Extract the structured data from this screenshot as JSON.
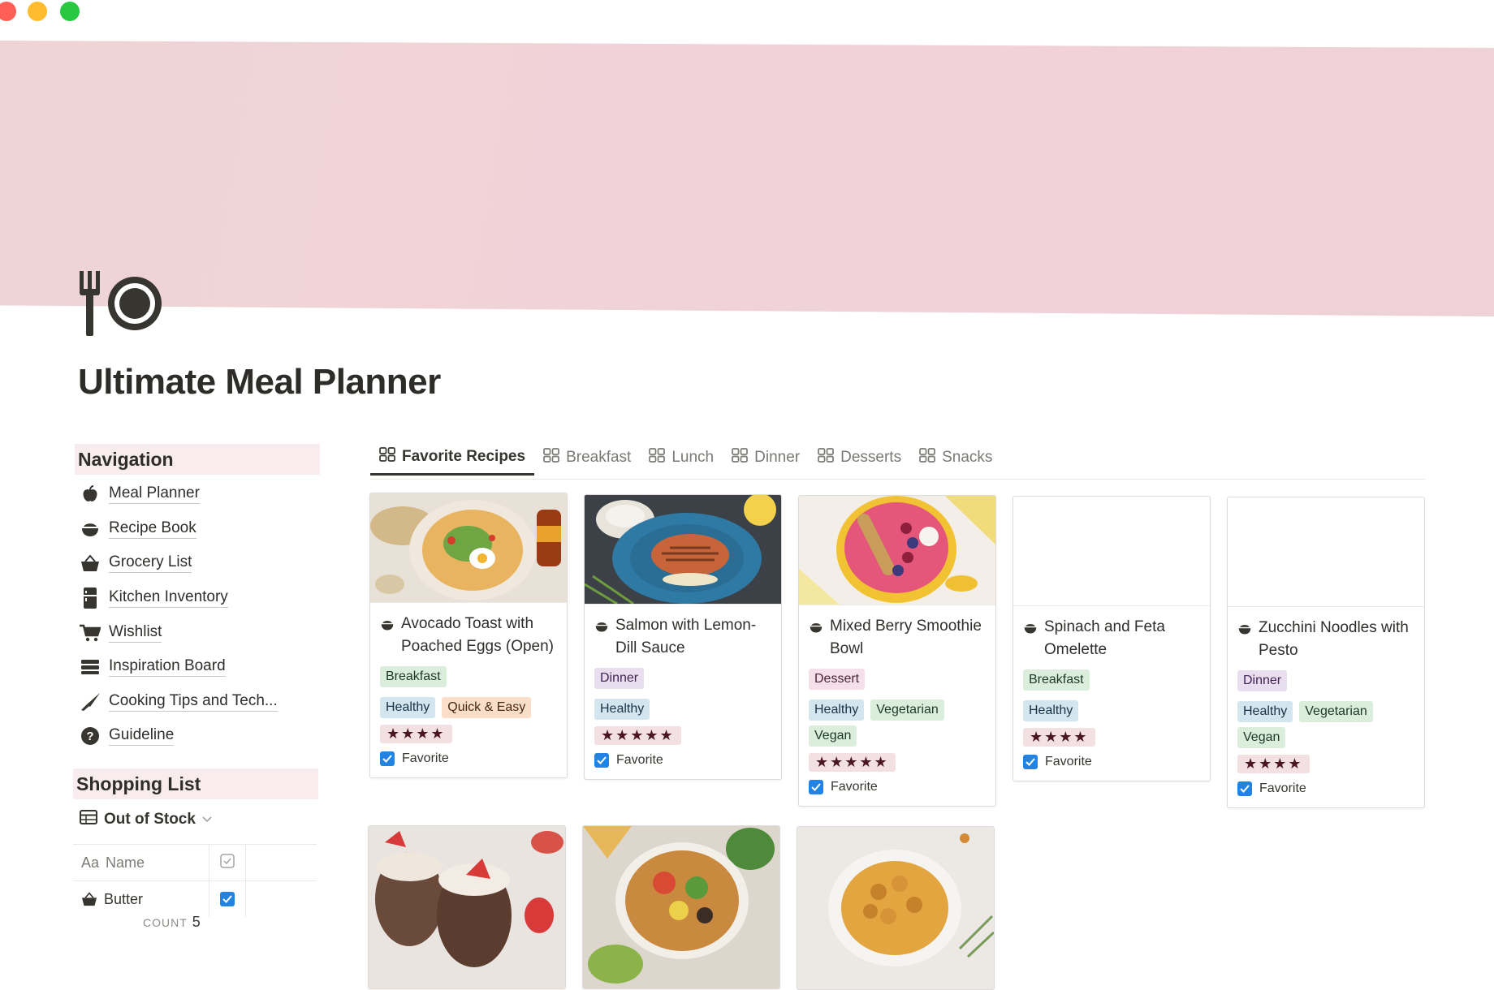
{
  "page": {
    "title": "Ultimate Meal Planner",
    "icon": "fork-plate-icon",
    "cover_color": "#efd3d7"
  },
  "sidebar": {
    "navigation_heading": "Navigation",
    "items": [
      {
        "label": "Meal Planner",
        "icon": "apple-icon"
      },
      {
        "label": "Recipe Book",
        "icon": "bowl-icon"
      },
      {
        "label": "Grocery List",
        "icon": "basket-icon"
      },
      {
        "label": "Kitchen Inventory",
        "icon": "fridge-icon"
      },
      {
        "label": "Wishlist",
        "icon": "cart-icon"
      },
      {
        "label": "Inspiration Board",
        "icon": "stack-icon"
      },
      {
        "label": "Cooking Tips and Tech...",
        "icon": "knife-icon"
      },
      {
        "label": "Guideline",
        "icon": "help-icon"
      }
    ],
    "shopping_heading": "Shopping List",
    "view_label": "Out of Stock",
    "table": {
      "name_header": "Name",
      "name_header_prefix": "Aa",
      "rows": [
        {
          "name": "Butter",
          "checked": true
        }
      ]
    },
    "count_label": "COUNT",
    "count_value": "5"
  },
  "tabs": [
    {
      "label": "Favorite Recipes",
      "active": true
    },
    {
      "label": "Breakfast",
      "active": false
    },
    {
      "label": "Lunch",
      "active": false
    },
    {
      "label": "Dinner",
      "active": false
    },
    {
      "label": "Desserts",
      "active": false
    },
    {
      "label": "Snacks",
      "active": false
    }
  ],
  "tag_colors": {
    "Breakfast": {
      "bg": "#dbeddb",
      "fg": "#1c3829"
    },
    "Dinner": {
      "bg": "#e8deee",
      "fg": "#412454"
    },
    "Dessert": {
      "bg": "#f5e0e9",
      "fg": "#4c2337"
    },
    "Healthy": {
      "bg": "#d3e5ef",
      "fg": "#183347"
    },
    "Quick & Easy": {
      "bg": "#fadec9",
      "fg": "#49290e"
    },
    "Vegetarian": {
      "bg": "#dbeddb",
      "fg": "#1c3829"
    },
    "Vegan": {
      "bg": "#dbeddb",
      "fg": "#1c3829"
    }
  },
  "favorite_label": "Favorite",
  "cards": [
    {
      "title": "Avocado Toast with Poached Eggs (Open)",
      "tags": [
        "Breakfast",
        "Healthy",
        "Quick & Easy"
      ],
      "rating": 4,
      "favorite": true,
      "has_image": true
    },
    {
      "title": "Salmon with Lemon-Dill Sauce",
      "tags": [
        "Dinner",
        "Healthy"
      ],
      "rating": 5,
      "favorite": true,
      "has_image": true
    },
    {
      "title": "Mixed Berry Smoothie Bowl",
      "tags": [
        "Dessert",
        "Healthy",
        "Vegetarian",
        "Vegan"
      ],
      "rating": 5,
      "favorite": true,
      "has_image": true
    },
    {
      "title": "Spinach and Feta Omelette",
      "tags": [
        "Breakfast",
        "Healthy"
      ],
      "rating": 4,
      "favorite": true,
      "has_image": false
    },
    {
      "title": "Zucchini Noodles with Pesto",
      "tags": [
        "Dinner",
        "Healthy",
        "Vegetarian",
        "Vegan"
      ],
      "rating": 4,
      "favorite": true,
      "has_image": false
    },
    {
      "title": "",
      "tags": [],
      "rating": 0,
      "favorite": false,
      "has_image": true
    },
    {
      "title": "",
      "tags": [],
      "rating": 0,
      "favorite": false,
      "has_image": true
    },
    {
      "title": "",
      "tags": [],
      "rating": 0,
      "favorite": false,
      "has_image": true
    }
  ]
}
